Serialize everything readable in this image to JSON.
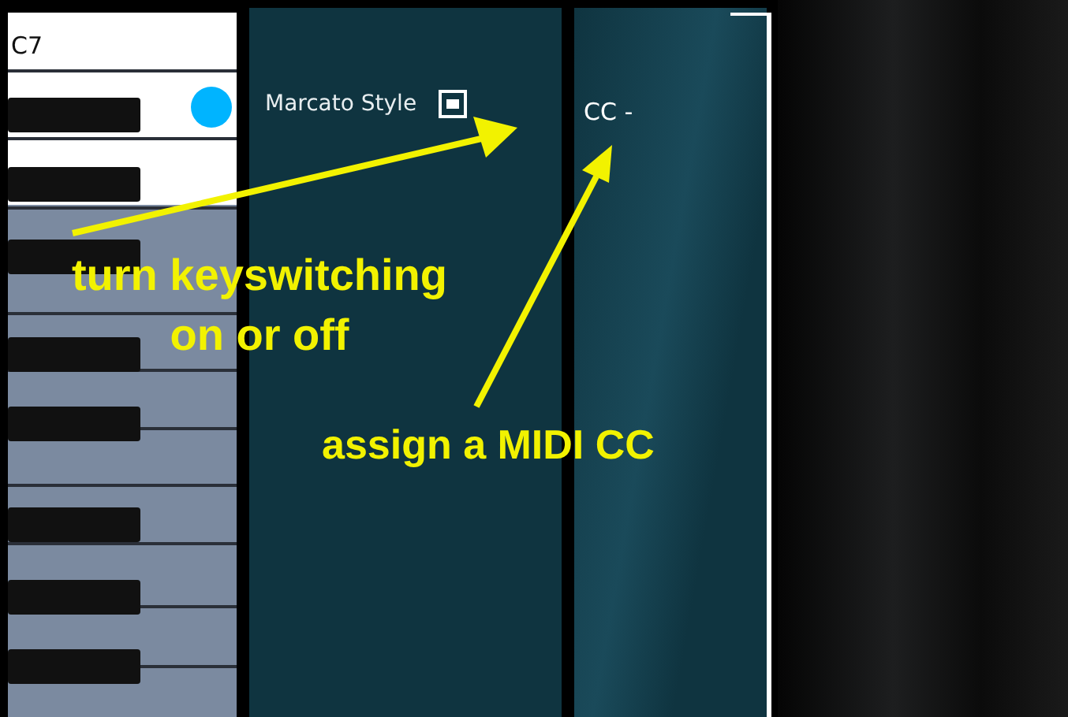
{
  "keyboard": {
    "note_label": "C7"
  },
  "keyswitch": {
    "label": "Marcato Style",
    "checked": true
  },
  "cc_assign": {
    "label": "CC -"
  },
  "annotations": [
    {
      "text": "turn keyswitching on or off"
    },
    {
      "text": "assign a MIDI CC"
    }
  ]
}
